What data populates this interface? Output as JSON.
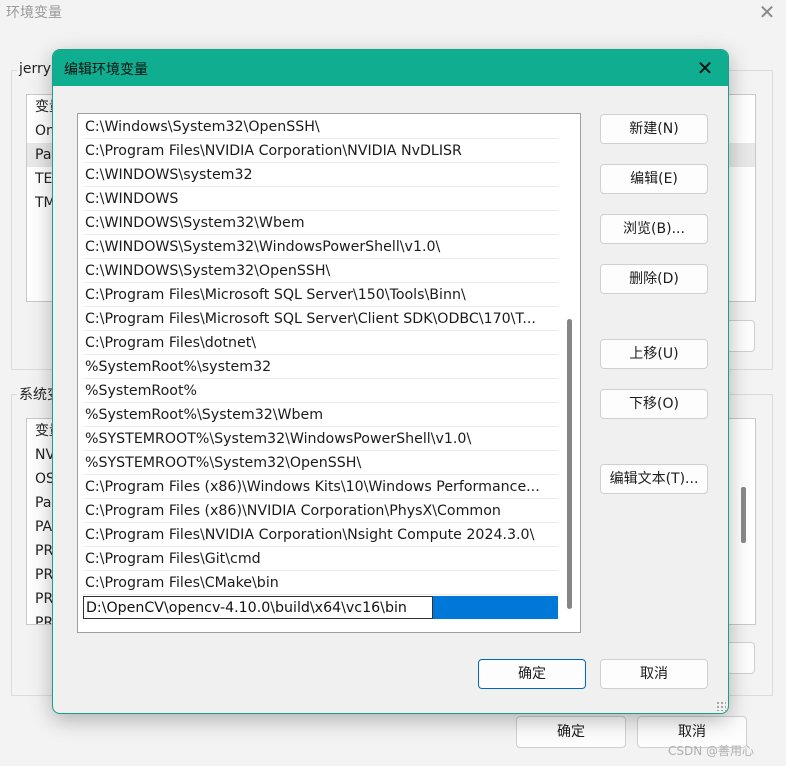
{
  "parent_window": {
    "title": "环境变量",
    "close_glyph": "✕",
    "user_group_label": "jerry",
    "user_rows": [
      "变量",
      "On",
      "Pa",
      "TE",
      "TM"
    ],
    "system_group_label": "系统变",
    "system_rows": [
      "变量",
      "NV",
      "OS",
      "Pa",
      "PA",
      "PR",
      "PR",
      "PR",
      "PR"
    ],
    "ok_label": "确定",
    "cancel_label": "取消"
  },
  "dialog": {
    "title": "编辑环境变量",
    "close_glyph": "✕",
    "paths": [
      "C:\\Windows\\System32\\OpenSSH\\",
      "C:\\Program Files\\NVIDIA Corporation\\NVIDIA NvDLISR",
      "C:\\WINDOWS\\system32",
      "C:\\WINDOWS",
      "C:\\WINDOWS\\System32\\Wbem",
      "C:\\WINDOWS\\System32\\WindowsPowerShell\\v1.0\\",
      "C:\\WINDOWS\\System32\\OpenSSH\\",
      "C:\\Program Files\\Microsoft SQL Server\\150\\Tools\\Binn\\",
      "C:\\Program Files\\Microsoft SQL Server\\Client SDK\\ODBC\\170\\T...",
      "C:\\Program Files\\dotnet\\",
      "%SystemRoot%\\system32",
      "%SystemRoot%",
      "%SystemRoot%\\System32\\Wbem",
      "%SYSTEMROOT%\\System32\\WindowsPowerShell\\v1.0\\",
      "%SYSTEMROOT%\\System32\\OpenSSH\\",
      "C:\\Program Files (x86)\\Windows Kits\\10\\Windows Performance...",
      "C:\\Program Files (x86)\\NVIDIA Corporation\\PhysX\\Common",
      "C:\\Program Files\\NVIDIA Corporation\\Nsight Compute 2024.3.0\\",
      "C:\\Program Files\\Git\\cmd",
      "C:\\Program Files\\CMake\\bin"
    ],
    "editing_value": "D:\\OpenCV\\opencv-4.10.0\\build\\x64\\vc16\\bin",
    "buttons": {
      "new": "新建(N)",
      "edit": "编辑(E)",
      "browse": "浏览(B)...",
      "delete": "删除(D)",
      "move_up": "上移(U)",
      "move_down": "下移(O)",
      "edit_text": "编辑文本(T)..."
    },
    "ok_label": "确定",
    "cancel_label": "取消",
    "accent_color": "#0fae90",
    "selection_color": "#0078d7"
  },
  "watermark": "CSDN @善用心"
}
